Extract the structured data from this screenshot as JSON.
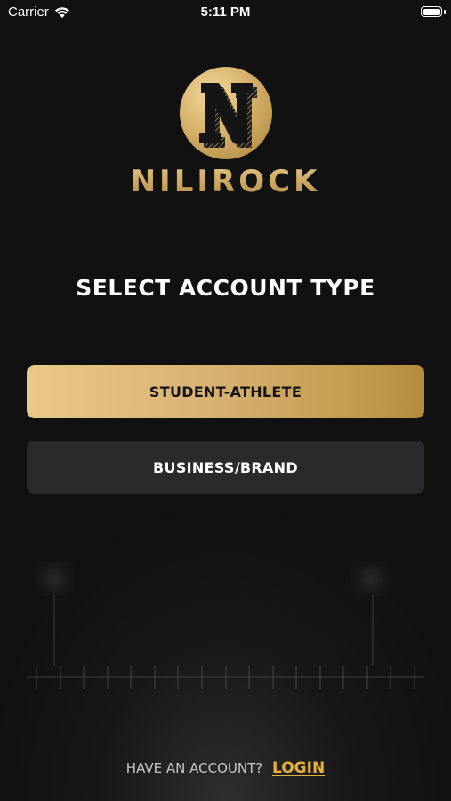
{
  "status_bar": {
    "carrier": "Carrier",
    "time": "5:11 PM"
  },
  "brand": {
    "logo_letter": "N",
    "name": "NILIROCK",
    "gold_color": "#c9a45c"
  },
  "heading": "SELECT ACCOUNT TYPE",
  "account_types": {
    "student_label": "STUDENT-ATHLETE",
    "business_label": "BUSINESS/BRAND"
  },
  "footer": {
    "prompt": "HAVE AN ACCOUNT?",
    "login_label": "LOGIN",
    "link_color": "#e4b13e"
  }
}
